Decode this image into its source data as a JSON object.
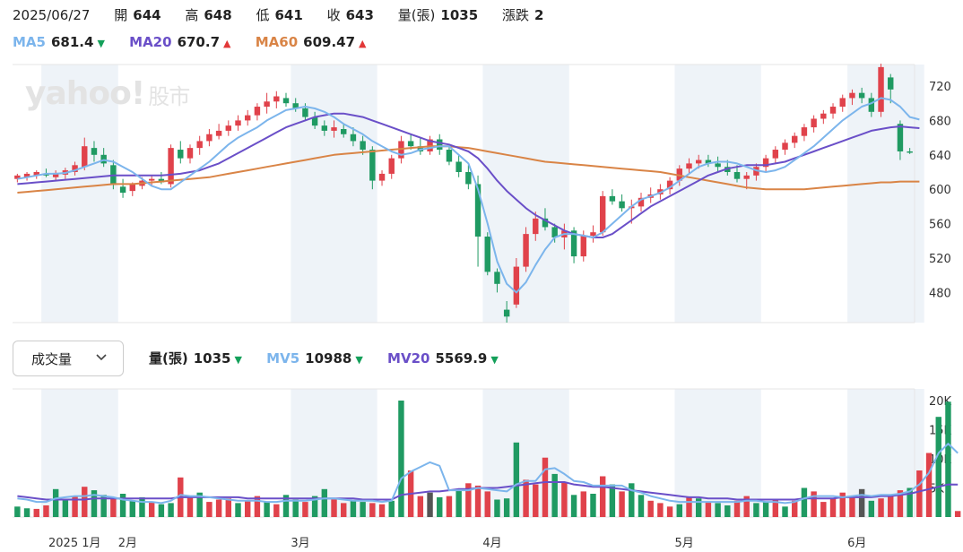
{
  "header": {
    "date": "2025/06/27",
    "open_label": "開",
    "open": "644",
    "high_label": "高",
    "high": "648",
    "low_label": "低",
    "low": "641",
    "close_label": "收",
    "close": "643",
    "volume_label": "量(張)",
    "volume": "1035",
    "change_label": "漲跌",
    "change": "2"
  },
  "ma": {
    "ma5_label": "MA5",
    "ma5_value": "681.4",
    "ma20_label": "MA20",
    "ma20_value": "670.7",
    "ma60_label": "MA60",
    "ma60_value": "609.47",
    "arrow_down": "▼",
    "arrow_up": "▲"
  },
  "logo": {
    "text": "yahoo!",
    "sub": "股市"
  },
  "volume_panel": {
    "selector_label": "成交量",
    "vol_label": "量(張)",
    "vol_value": "1035",
    "mv5_label": "MV5",
    "mv5_value": "10988",
    "mv20_label": "MV20",
    "mv20_value": "5569.9"
  },
  "colors": {
    "up": "#e0424b",
    "down": "#1f9a62",
    "flat": "#555555",
    "ma5": "#7cb5ec",
    "ma20": "#6a4fc8",
    "ma60": "#d98446",
    "band": "#eef3f8",
    "grid": "#e6e6e6"
  },
  "chart_data": [
    {
      "type": "candlestick",
      "x_labels": [
        "2025 1月",
        "2月",
        "3月",
        "4月",
        "5月",
        "6月"
      ],
      "x_label_positions": [
        0,
        11,
        29,
        49,
        69,
        87
      ],
      "y_ticks": [
        480,
        520,
        560,
        600,
        640,
        680,
        720
      ],
      "ylim": [
        445,
        745
      ],
      "candles": [
        [
          612,
          618,
          608,
          616
        ],
        [
          614,
          620,
          610,
          618
        ],
        [
          616,
          622,
          612,
          620
        ],
        [
          618,
          624,
          614,
          616
        ],
        [
          614,
          622,
          610,
          619
        ],
        [
          617,
          625,
          612,
          622
        ],
        [
          620,
          632,
          616,
          628
        ],
        [
          626,
          660,
          622,
          650
        ],
        [
          648,
          656,
          632,
          640
        ],
        [
          640,
          648,
          626,
          630
        ],
        [
          628,
          634,
          600,
          605
        ],
        [
          603,
          612,
          590,
          596
        ],
        [
          598,
          608,
          592,
          606
        ],
        [
          604,
          614,
          600,
          610
        ],
        [
          610,
          616,
          604,
          612
        ],
        [
          612,
          620,
          606,
          608
        ],
        [
          606,
          652,
          602,
          648
        ],
        [
          646,
          656,
          630,
          636
        ],
        [
          636,
          652,
          630,
          648
        ],
        [
          648,
          662,
          640,
          656
        ],
        [
          656,
          670,
          650,
          664
        ],
        [
          662,
          676,
          658,
          668
        ],
        [
          668,
          680,
          662,
          674
        ],
        [
          674,
          686,
          668,
          680
        ],
        [
          680,
          692,
          674,
          686
        ],
        [
          686,
          700,
          680,
          696
        ],
        [
          696,
          712,
          688,
          702
        ],
        [
          702,
          714,
          694,
          708
        ],
        [
          706,
          712,
          696,
          700
        ],
        [
          700,
          706,
          690,
          694
        ],
        [
          694,
          700,
          680,
          684
        ],
        [
          684,
          690,
          670,
          674
        ],
        [
          674,
          680,
          662,
          668
        ],
        [
          668,
          680,
          660,
          672
        ],
        [
          670,
          676,
          660,
          664
        ],
        [
          664,
          672,
          650,
          656
        ],
        [
          656,
          662,
          640,
          646
        ],
        [
          646,
          650,
          600,
          610
        ],
        [
          610,
          622,
          604,
          618
        ],
        [
          618,
          640,
          612,
          636
        ],
        [
          636,
          662,
          630,
          656
        ],
        [
          656,
          664,
          646,
          650
        ],
        [
          650,
          660,
          640,
          644
        ],
        [
          644,
          662,
          640,
          658
        ],
        [
          658,
          664,
          640,
          646
        ],
        [
          646,
          652,
          628,
          632
        ],
        [
          632,
          640,
          614,
          620
        ],
        [
          620,
          628,
          600,
          606
        ],
        [
          606,
          616,
          510,
          545
        ],
        [
          545,
          550,
          500,
          504
        ],
        [
          504,
          508,
          480,
          490
        ],
        [
          460,
          470,
          445,
          452
        ],
        [
          466,
          520,
          462,
          510
        ],
        [
          510,
          556,
          504,
          548
        ],
        [
          548,
          574,
          540,
          566
        ],
        [
          566,
          578,
          552,
          556
        ],
        [
          556,
          560,
          538,
          544
        ],
        [
          544,
          560,
          530,
          552
        ],
        [
          552,
          556,
          514,
          522
        ],
        [
          522,
          552,
          516,
          546
        ],
        [
          546,
          558,
          538,
          550
        ],
        [
          550,
          598,
          546,
          592
        ],
        [
          592,
          600,
          582,
          586
        ],
        [
          586,
          594,
          574,
          578
        ],
        [
          578,
          588,
          560,
          580
        ],
        [
          580,
          596,
          574,
          590
        ],
        [
          590,
          602,
          584,
          594
        ],
        [
          594,
          606,
          588,
          600
        ],
        [
          600,
          614,
          594,
          610
        ],
        [
          610,
          628,
          604,
          624
        ],
        [
          624,
          636,
          618,
          630
        ],
        [
          630,
          640,
          624,
          634
        ],
        [
          634,
          640,
          626,
          630
        ],
        [
          630,
          638,
          620,
          626
        ],
        [
          626,
          634,
          616,
          620
        ],
        [
          620,
          628,
          608,
          612
        ],
        [
          612,
          620,
          600,
          616
        ],
        [
          616,
          630,
          610,
          626
        ],
        [
          626,
          640,
          620,
          636
        ],
        [
          636,
          650,
          630,
          646
        ],
        [
          646,
          658,
          640,
          654
        ],
        [
          654,
          666,
          648,
          662
        ],
        [
          662,
          676,
          656,
          672
        ],
        [
          672,
          686,
          666,
          682
        ],
        [
          682,
          692,
          676,
          688
        ],
        [
          688,
          700,
          682,
          696
        ],
        [
          696,
          710,
          690,
          706
        ],
        [
          706,
          716,
          698,
          712
        ],
        [
          712,
          718,
          700,
          706
        ],
        [
          706,
          712,
          684,
          690
        ],
        [
          690,
          746,
          684,
          742
        ],
        [
          730,
          734,
          700,
          716
        ],
        [
          676,
          680,
          634,
          644
        ],
        [
          644,
          648,
          641,
          643
        ]
      ],
      "ma5": [
        612,
        614,
        616,
        618,
        618,
        619,
        622,
        626,
        630,
        634,
        632,
        626,
        620,
        612,
        604,
        600,
        600,
        608,
        616,
        624,
        632,
        642,
        652,
        660,
        666,
        672,
        680,
        686,
        692,
        694,
        696,
        694,
        690,
        684,
        676,
        670,
        664,
        656,
        650,
        644,
        640,
        642,
        646,
        648,
        650,
        650,
        640,
        630,
        600,
        560,
        516,
        490,
        480,
        492,
        512,
        530,
        544,
        548,
        548,
        546,
        544,
        550,
        560,
        570,
        580,
        588,
        592,
        596,
        602,
        610,
        618,
        626,
        630,
        632,
        632,
        630,
        626,
        622,
        620,
        622,
        626,
        634,
        642,
        650,
        660,
        670,
        680,
        688,
        696,
        700,
        706,
        704,
        696,
        684,
        681
      ],
      "ma20": [
        606,
        607,
        608,
        609,
        610,
        611,
        612,
        613,
        614,
        615,
        616,
        616,
        616,
        616,
        616,
        616,
        617,
        618,
        620,
        622,
        626,
        630,
        636,
        642,
        648,
        654,
        660,
        666,
        672,
        676,
        680,
        684,
        686,
        688,
        688,
        686,
        684,
        680,
        676,
        672,
        668,
        664,
        660,
        656,
        654,
        652,
        648,
        644,
        636,
        624,
        610,
        598,
        588,
        578,
        570,
        564,
        558,
        552,
        548,
        546,
        544,
        544,
        548,
        556,
        564,
        572,
        580,
        586,
        592,
        598,
        604,
        610,
        616,
        620,
        624,
        626,
        628,
        628,
        628,
        630,
        632,
        636,
        640,
        644,
        648,
        652,
        656,
        660,
        664,
        668,
        670,
        672,
        673,
        672,
        671
      ],
      "ma60": [
        596,
        597,
        598,
        599,
        600,
        601,
        602,
        603,
        604,
        605,
        606,
        606,
        606,
        607,
        608,
        609,
        610,
        611,
        612,
        613,
        614,
        616,
        618,
        620,
        622,
        624,
        626,
        628,
        630,
        632,
        634,
        636,
        638,
        640,
        641,
        642,
        643,
        644,
        645,
        646,
        647,
        648,
        649,
        650,
        650,
        650,
        649,
        648,
        646,
        644,
        642,
        640,
        638,
        636,
        634,
        632,
        631,
        630,
        629,
        628,
        627,
        626,
        625,
        624,
        623,
        622,
        621,
        620,
        618,
        616,
        614,
        612,
        610,
        608,
        606,
        604,
        602,
        601,
        600,
        600,
        600,
        600,
        600,
        601,
        602,
        603,
        604,
        605,
        606,
        607,
        608,
        608,
        609,
        609,
        609
      ],
      "bands": [
        [
          3,
          11
        ],
        [
          29,
          38
        ],
        [
          49,
          58
        ],
        [
          69,
          78
        ],
        [
          87,
          95
        ]
      ]
    },
    {
      "type": "bar",
      "y_ticks": [
        5000,
        10000,
        15000,
        20000
      ],
      "y_tick_labels": [
        "5K",
        "10K",
        "15K",
        "20K"
      ],
      "ylim": [
        0,
        22000
      ],
      "volumes": [
        1800,
        1500,
        1400,
        2000,
        4800,
        3000,
        3600,
        5200,
        4600,
        3800,
        3200,
        4000,
        2800,
        3400,
        2600,
        2200,
        2400,
        6800,
        3400,
        4200,
        2600,
        3000,
        3200,
        2400,
        2800,
        3600,
        2600,
        2200,
        3800,
        3000,
        2600,
        3600,
        4800,
        3000,
        2400,
        2800,
        2600,
        2400,
        2200,
        2800,
        20000,
        8000,
        3600,
        4200,
        3400,
        3600,
        4600,
        5800,
        5400,
        4400,
        3000,
        3200,
        12800,
        6400,
        5600,
        10200,
        7400,
        6000,
        3800,
        4400,
        4000,
        7000,
        5600,
        4400,
        5800,
        3800,
        2800,
        2400,
        1800,
        2200,
        3400,
        3200,
        2600,
        2400,
        2000,
        2800,
        3600,
        2400,
        2600,
        3000,
        1800,
        2800,
        5000,
        4400,
        2600,
        3200,
        4200,
        3400,
        4800,
        2800,
        3200,
        3800,
        4600,
        5000,
        8000,
        11000,
        17200,
        19800,
        1035
      ],
      "volume_dir": [
        "d",
        "d",
        "u",
        "u",
        "d",
        "d",
        "u",
        "u",
        "d",
        "d",
        "u",
        "d",
        "d",
        "d",
        "u",
        "d",
        "d",
        "u",
        "u",
        "d",
        "u",
        "u",
        "u",
        "d",
        "u",
        "u",
        "d",
        "u",
        "d",
        "d",
        "u",
        "d",
        "d",
        "u",
        "u",
        "d",
        "d",
        "u",
        "u",
        "d",
        "d",
        "u",
        "u",
        "f",
        "d",
        "u",
        "d",
        "u",
        "u",
        "u",
        "d",
        "d",
        "d",
        "u",
        "u",
        "u",
        "d",
        "u",
        "d",
        "u",
        "d",
        "u",
        "d",
        "u",
        "d",
        "d",
        "u",
        "u",
        "u",
        "d",
        "u",
        "d",
        "u",
        "d",
        "d",
        "u",
        "u",
        "d",
        "d",
        "u",
        "d",
        "u",
        "d",
        "u",
        "u",
        "u",
        "u",
        "u",
        "f",
        "d",
        "u",
        "u",
        "u",
        "d",
        "u",
        "u",
        "d",
        "d",
        "u"
      ],
      "mv5": [
        3200,
        3000,
        2600,
        2600,
        3200,
        3400,
        3600,
        3600,
        3800,
        3600,
        3400,
        3000,
        2800,
        2600,
        2600,
        2400,
        2800,
        3800,
        3600,
        3600,
        3400,
        3200,
        3000,
        2800,
        2800,
        2800,
        2600,
        2600,
        2800,
        2800,
        2800,
        3000,
        3200,
        3200,
        3000,
        2800,
        2800,
        2800,
        2600,
        2800,
        6600,
        7800,
        8600,
        9400,
        8800,
        4600,
        4600,
        4600,
        5000,
        4800,
        4600,
        4400,
        5600,
        6200,
        6200,
        8200,
        8400,
        7400,
        6200,
        6000,
        5400,
        5400,
        5400,
        5400,
        4600,
        4200,
        3600,
        3200,
        2800,
        2600,
        2600,
        2600,
        2600,
        2600,
        2600,
        2600,
        2800,
        2800,
        2600,
        2600,
        2400,
        2600,
        3200,
        3600,
        3600,
        3600,
        3400,
        3600,
        3800,
        3600,
        3800,
        3800,
        4000,
        4400,
        5600,
        7600,
        11000,
        12600,
        10988
      ],
      "mv20": [
        3600,
        3400,
        3200,
        3000,
        3000,
        3000,
        3000,
        3000,
        3200,
        3200,
        3200,
        3200,
        3200,
        3200,
        3200,
        3200,
        3200,
        3400,
        3400,
        3400,
        3400,
        3400,
        3400,
        3400,
        3200,
        3200,
        3200,
        3200,
        3200,
        3200,
        3200,
        3200,
        3200,
        3200,
        3200,
        3200,
        3000,
        3000,
        3000,
        3000,
        3800,
        4000,
        4200,
        4400,
        4400,
        4600,
        4800,
        4800,
        5000,
        5000,
        5000,
        5200,
        5400,
        5600,
        5800,
        6000,
        6000,
        6000,
        5600,
        5400,
        5200,
        5200,
        5000,
        4800,
        4600,
        4400,
        4200,
        4000,
        3800,
        3600,
        3400,
        3400,
        3200,
        3200,
        3200,
        3000,
        3000,
        3000,
        3000,
        3000,
        3000,
        3000,
        3200,
        3200,
        3200,
        3200,
        3400,
        3400,
        3400,
        3400,
        3600,
        3600,
        3800,
        4000,
        4400,
        4800,
        5200,
        5600,
        5570
      ]
    }
  ]
}
